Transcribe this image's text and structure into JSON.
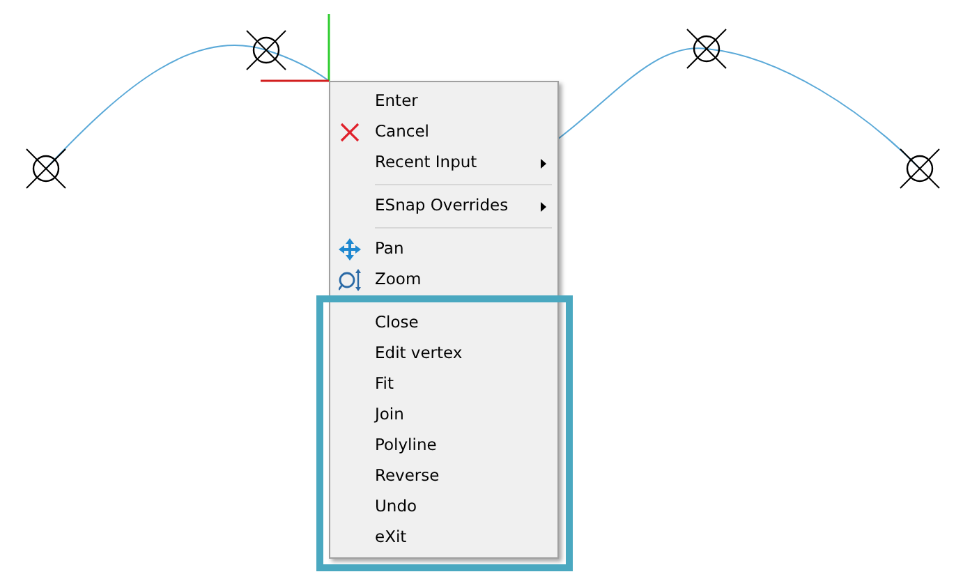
{
  "context_menu": {
    "items": [
      {
        "kind": "plain",
        "label": "Enter"
      },
      {
        "kind": "cancel",
        "label": "Cancel"
      },
      {
        "kind": "submenu",
        "label": "Recent Input"
      },
      {
        "kind": "separator"
      },
      {
        "kind": "submenu",
        "label": "ESnap Overrides"
      },
      {
        "kind": "separator"
      },
      {
        "kind": "pan",
        "label": "Pan"
      },
      {
        "kind": "zoom",
        "label": "Zoom"
      }
    ],
    "highlighted_items": [
      {
        "kind": "plain",
        "label": "Close"
      },
      {
        "kind": "plain",
        "label": "Edit vertex"
      },
      {
        "kind": "plain",
        "label": "Fit"
      },
      {
        "kind": "plain",
        "label": "Join"
      },
      {
        "kind": "plain",
        "label": "Polyline"
      },
      {
        "kind": "plain",
        "label": "Reverse"
      },
      {
        "kind": "plain",
        "label": "Undo"
      },
      {
        "kind": "plain",
        "label": "eXit"
      }
    ]
  }
}
